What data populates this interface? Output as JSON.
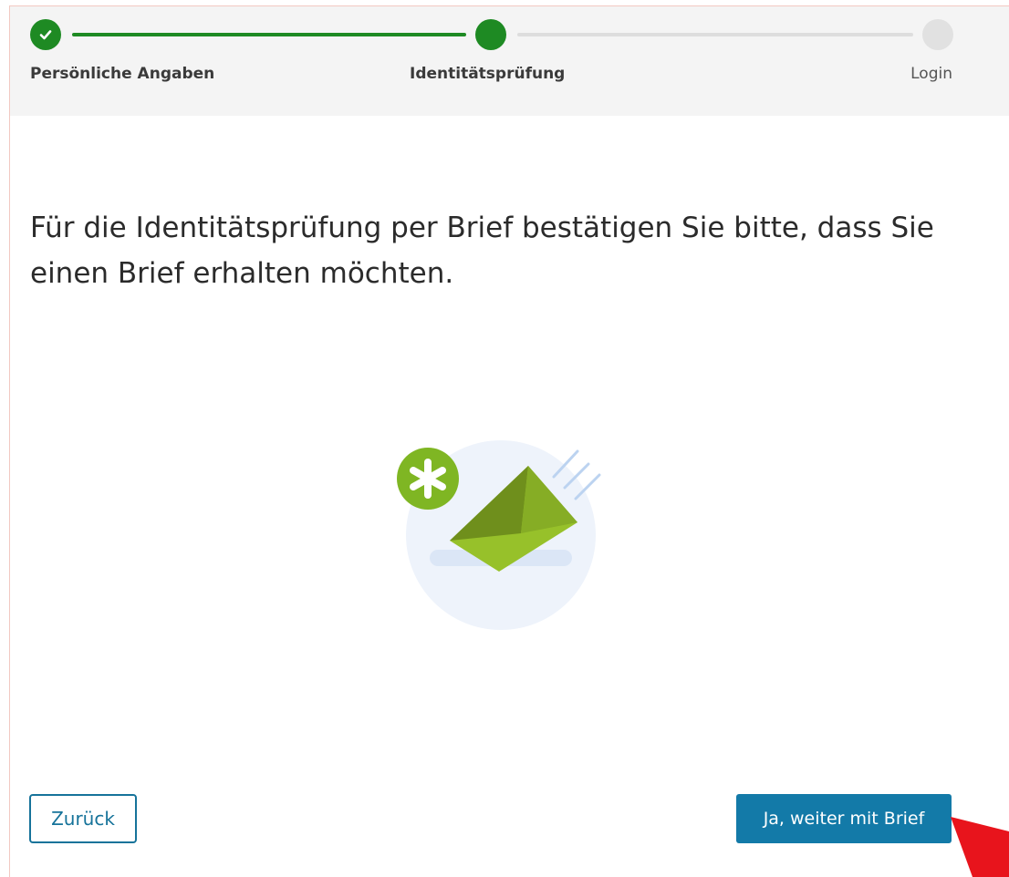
{
  "stepper": {
    "steps": [
      {
        "label": "Persönliche Angaben",
        "state": "done",
        "icon": "check-icon"
      },
      {
        "label": "Identitätsprüfung",
        "state": "active",
        "icon": "dot"
      },
      {
        "label": "Login",
        "state": "pending",
        "icon": "dot"
      }
    ],
    "colors": {
      "done": "#1e8a23",
      "pending": "#e1e1e1"
    }
  },
  "main": {
    "headline": "Für die Identitätsprüfung per Brief bestätigen Sie bitte, dass Sie einen Brief erhalten möchten.",
    "illustration_icon": "letter-envelope-icon"
  },
  "actions": {
    "back_label": "Zurück",
    "next_label": "Ja, weiter mit Brief"
  },
  "colors": {
    "primary": "#137aa8",
    "accent_green": "#97c12a"
  }
}
